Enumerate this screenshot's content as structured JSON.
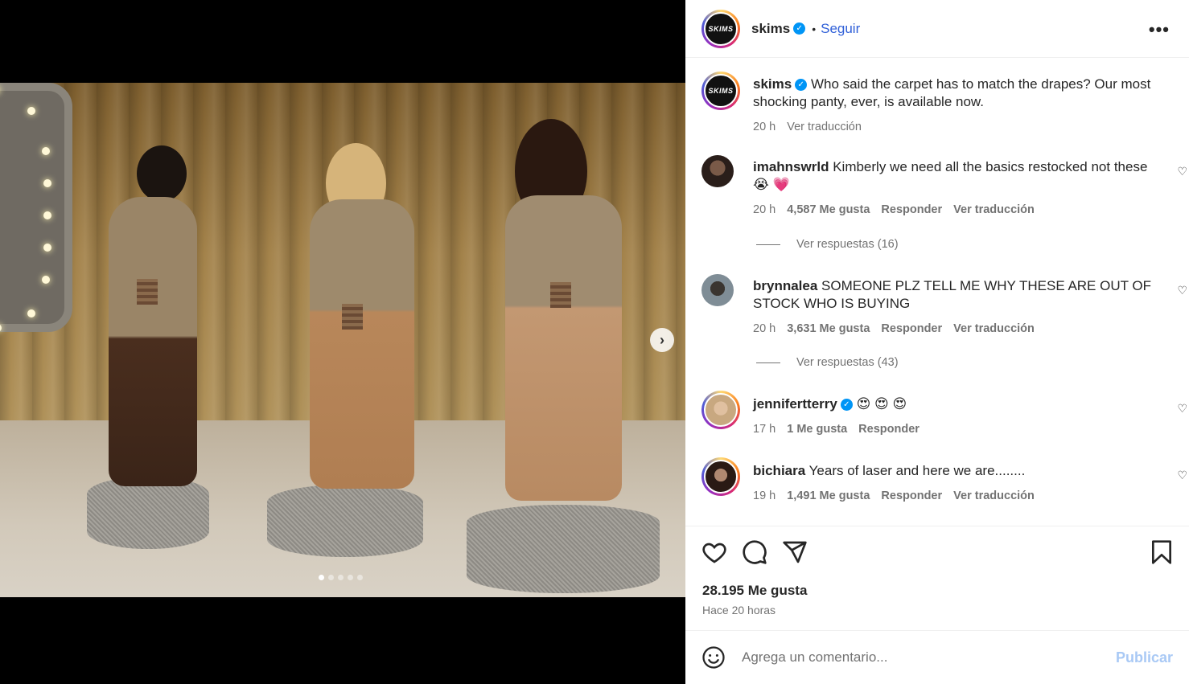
{
  "post": {
    "username": "skims",
    "avatar_text": "SKIMS",
    "follow_label": "Seguir",
    "separator": "•",
    "more_label": "•••",
    "caption": "Who said the carpet has to match the drapes? Our most shocking panty, ever, is available now.",
    "caption_time": "20 h",
    "see_translation": "Ver traducción",
    "carousel_count": 5,
    "carousel_active_index": 0
  },
  "comments": [
    {
      "username": "imahnswrld",
      "text": "Kimberly we need all the basics restocked not these 😭 💗",
      "time": "20 h",
      "likes": "4,587 Me gusta",
      "reply": "Responder",
      "translate": "Ver traducción",
      "replies": "Ver respuestas (16)"
    },
    {
      "username": "brynnalea",
      "text": "SOMEONE PLZ TELL ME WHY THESE ARE OUT OF STOCK WHO IS BUYING",
      "time": "20 h",
      "likes": "3,631 Me gusta",
      "reply": "Responder",
      "translate": "Ver traducción",
      "replies": "Ver respuestas (43)"
    },
    {
      "username": "jennifertterry",
      "text": "😍 😍 😍",
      "time": "17 h",
      "likes": "1 Me gusta",
      "reply": "Responder"
    },
    {
      "username": "bichiara",
      "text": "Years of laser and here we are........",
      "time": "19 h",
      "likes": "1,491 Me gusta",
      "reply": "Responder",
      "translate": "Ver traducción"
    }
  ],
  "footer": {
    "likes_count": "28.195 Me gusta",
    "posted": "Hace 20 horas",
    "comment_placeholder": "Agrega un comentario...",
    "publish_label": "Publicar"
  },
  "colors": {
    "verified": "#0095f6",
    "follow": "#3060d8",
    "publish_disabled": "#a9c9f5"
  }
}
